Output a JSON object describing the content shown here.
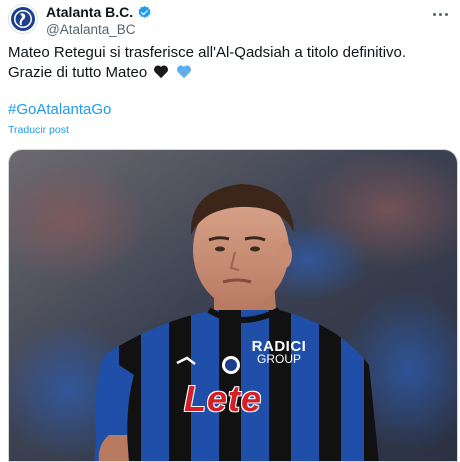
{
  "account": {
    "display_name": "Atalanta B.C.",
    "handle": "@Atalanta_BC",
    "verified": true,
    "avatar_icon": "atalanta-crest-icon"
  },
  "tweet": {
    "line1": "Mateo Retegui si trasferisce all'Al-Qadsiah a titolo definitivo.",
    "line2": "Grazie di tutto Mateo",
    "emojis": [
      "black-heart-icon",
      "blue-heart-icon"
    ],
    "hashtag": "#GoAtalantaGo",
    "translate_label": "Traducir post"
  },
  "media": {
    "description_icon": "player-photo",
    "jersey_sponsor_top_line1": "RADICI",
    "jersey_sponsor_top_line2": "GROUP",
    "jersey_sponsor_main": "Lete"
  },
  "colors": {
    "accent": "#1d9bf0",
    "text": "#0f1419",
    "muted": "#536471",
    "jersey_blue": "#1f4fa8",
    "jersey_black": "#111111",
    "sponsor_red": "#d41f26"
  }
}
